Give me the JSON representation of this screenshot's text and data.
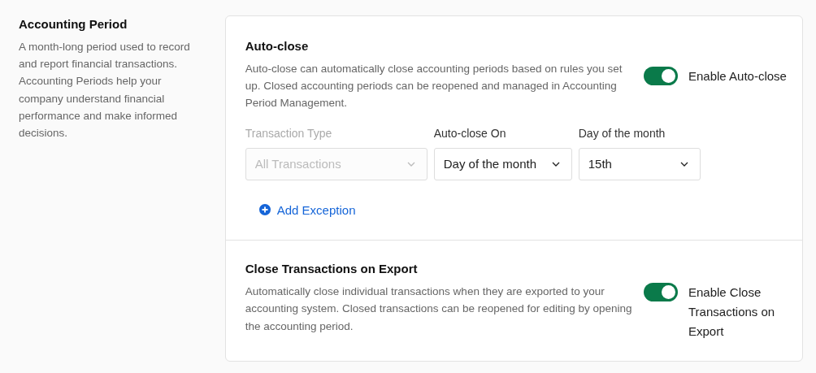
{
  "intro": {
    "title": "Accounting Period",
    "description": "A month-long period used to record and report financial transactions. Accounting Periods help your company understand financial performance and make informed decisions."
  },
  "sections": [
    {
      "title": "Auto-close",
      "description": "Auto-close can automatically close accounting periods based on rules you set up. Closed accounting periods can be reopened and managed in Accounting Period Management.",
      "toggle": {
        "label": "Enable Auto-close",
        "on": true
      },
      "selects": [
        {
          "label": "Transaction Type",
          "value": "All Transactions",
          "disabled": true
        },
        {
          "label": "Auto-close On",
          "value": "Day of the month",
          "disabled": false
        },
        {
          "label": "Day of the month",
          "value": "15th",
          "disabled": false
        }
      ],
      "action": {
        "label": "Add Exception"
      }
    },
    {
      "title": "Close Transactions on Export",
      "description": "Automatically close individual transactions when they are exported to your accounting system. Closed transactions can be reopened for editing by opening the accounting period.",
      "toggle": {
        "label": "Enable Close Transactions on Export",
        "on": true
      }
    }
  ]
}
